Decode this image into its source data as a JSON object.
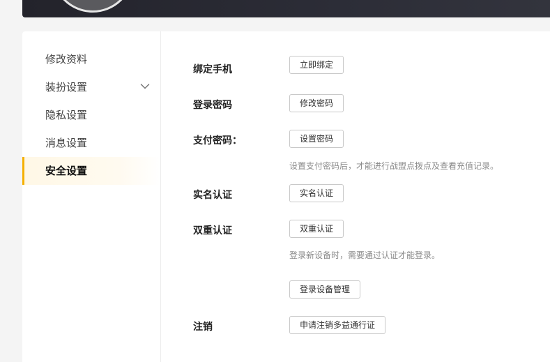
{
  "sidebar": {
    "items": [
      {
        "label": "修改资料",
        "active": false
      },
      {
        "label": "装扮设置",
        "active": false,
        "has_submenu": true
      },
      {
        "label": "隐私设置",
        "active": false
      },
      {
        "label": "消息设置",
        "active": false
      },
      {
        "label": "安全设置",
        "active": true
      }
    ]
  },
  "security": {
    "bind_phone": {
      "label": "绑定手机",
      "button": "立即绑定"
    },
    "login_password": {
      "label": "登录密码",
      "button": "修改密码"
    },
    "pay_password": {
      "label": "支付密码：",
      "button": "设置密码",
      "hint": "设置支付密码后，才能进行战盟点拨点及查看充值记录。"
    },
    "real_name": {
      "label": "实名认证",
      "button": "实名认证"
    },
    "two_factor": {
      "label": "双重认证",
      "button": "双重认证",
      "hint": "登录新设备时，需要通过认证才能登录。"
    },
    "device_management": {
      "button": "登录设备管理"
    },
    "cancel_account": {
      "label": "注销",
      "button": "申请注销多益通行证"
    }
  },
  "colors": {
    "accent": "#f5b000",
    "active_bg": "#fff8e6",
    "hint_text": "#8a8a8a",
    "banner_bg": "#2c2d37"
  },
  "icons": {
    "submenu_indicator": "chevron-down-icon"
  }
}
